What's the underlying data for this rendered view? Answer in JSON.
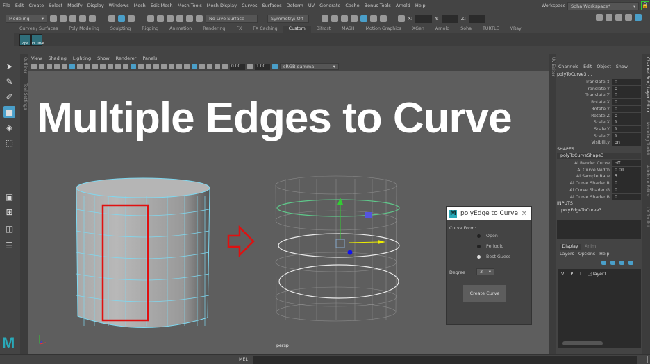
{
  "menubar": [
    "File",
    "Edit",
    "Create",
    "Select",
    "Modify",
    "Display",
    "Windows",
    "Mesh",
    "Edit Mesh",
    "Mesh Tools",
    "Mesh Display",
    "Curves",
    "Surfaces",
    "Deform",
    "UV",
    "Generate",
    "Cache",
    "Bonus Tools",
    "Arnold",
    "Help"
  ],
  "toolbar": {
    "mode": "Modeling",
    "live_surface": "No Live Surface",
    "symmetry": "Symmetry: Off",
    "x_label": "X:",
    "y_label": "Y:",
    "z_label": "Z:",
    "workspace_label": "Workspace :",
    "workspace": "Soha Workspace*"
  },
  "shelf_tabs": [
    "Curves / Surfaces",
    "Poly Modeling",
    "Sculpting",
    "Rigging",
    "Animation",
    "Rendering",
    "FX",
    "FX Caching",
    "Custom",
    "Bifrost",
    "MASH",
    "Motion Graphics",
    "XGen",
    "Arnold",
    "Soha",
    "TURTLE",
    "VRay"
  ],
  "shelf_active": "Custom",
  "shelf_buttons": [
    "Pipe",
    "ECurve"
  ],
  "side_strips": {
    "outliner": "Outliner",
    "tool_settings": "Tool Settings",
    "uv_editor": "UV Editor",
    "channel_box": "Channel Box / Layer Editor",
    "modeling_toolkit": "Modeling Toolkit",
    "attribute_editor": "Attribute Editor",
    "uv_toolkit": "UV Toolkit"
  },
  "viewport": {
    "menu": [
      "View",
      "Shading",
      "Lighting",
      "Show",
      "Renderer",
      "Panels"
    ],
    "exposure": "0.00",
    "gamma": "1.00",
    "color_space": "sRGB gamma",
    "camera": "persp"
  },
  "overlay_title": "Multiple Edges to Curve",
  "dialog": {
    "title": "polyEdge to Curve",
    "curve_form_label": "Curve Form:",
    "options": [
      "Open",
      "Periodic",
      "Best Guess"
    ],
    "selected": "Best Guess",
    "degree_label": "Degree",
    "degree_value": "3",
    "create_button": "Create Curve"
  },
  "channel_box": {
    "menu": [
      "Channels",
      "Edit",
      "Object",
      "Show"
    ],
    "object": "polyToCurve3 . . .",
    "attrs": [
      {
        "l": "Translate X",
        "v": "0"
      },
      {
        "l": "Translate Y",
        "v": "0"
      },
      {
        "l": "Translate Z",
        "v": "0"
      },
      {
        "l": "Rotate X",
        "v": "0"
      },
      {
        "l": "Rotate Y",
        "v": "0"
      },
      {
        "l": "Rotate Z",
        "v": "0"
      },
      {
        "l": "Scale X",
        "v": "1"
      },
      {
        "l": "Scale Y",
        "v": "1"
      },
      {
        "l": "Scale Z",
        "v": "1"
      },
      {
        "l": "Visibility",
        "v": "on"
      }
    ],
    "shapes_label": "SHAPES",
    "shape": "polyToCurveShape3",
    "shape_attrs": [
      {
        "l": "Ai Render Curve",
        "v": "off"
      },
      {
        "l": "Ai Curve Width",
        "v": "0.01"
      },
      {
        "l": "Ai Sample Rate",
        "v": "5"
      },
      {
        "l": "Ai Curve Shader R",
        "v": "0"
      },
      {
        "l": "Ai Curve Shader G",
        "v": "0"
      },
      {
        "l": "Ai Curve Shader B",
        "v": "0"
      }
    ],
    "inputs_label": "INPUTS",
    "input": "polyEdgeToCurve3"
  },
  "layer_editor": {
    "tabs": [
      "Display",
      "Anim"
    ],
    "menu": [
      "Layers",
      "Options",
      "Help"
    ],
    "layer": {
      "v": "V",
      "p": "P",
      "t": "T",
      "name": "layer1"
    }
  },
  "bottom": {
    "mel": "MEL"
  },
  "colors": {
    "accent": "#4a9fc9",
    "highlight_red": "#e01010",
    "maya_teal": "#2aa9b8"
  }
}
